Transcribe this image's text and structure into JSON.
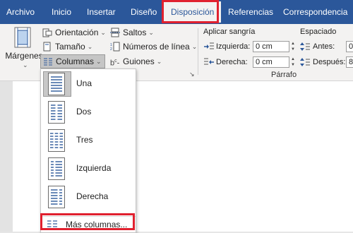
{
  "tabs": [
    {
      "label": "Archivo"
    },
    {
      "label": "Inicio"
    },
    {
      "label": "Insertar"
    },
    {
      "label": "Diseño"
    },
    {
      "label": "Disposición",
      "active": true
    },
    {
      "label": "Referencias"
    },
    {
      "label": "Correspondencia"
    }
  ],
  "ribbon": {
    "margins_label": "Márgenes",
    "orientation_label": "Orientación",
    "size_label": "Tamaño",
    "columns_label": "Columnas",
    "breaks_label": "Saltos",
    "line_numbers_label": "Números de línea",
    "hyphenation_label": "Guiones",
    "indent_title": "Aplicar sangría",
    "indent_left_label": "Izquierda:",
    "indent_left_value": "0 cm",
    "indent_right_label": "Derecha:",
    "indent_right_value": "0 cm",
    "spacing_title": "Espaciado",
    "spacing_before_label": "Antes:",
    "spacing_before_value": "0",
    "spacing_after_label": "Después:",
    "spacing_after_value": "8",
    "paragraph_group_label": "Párrafo"
  },
  "columns_menu": {
    "items": [
      {
        "label": "Una",
        "icon": "one-column-icon",
        "selected": true
      },
      {
        "label": "Dos",
        "icon": "two-columns-icon"
      },
      {
        "label": "Tres",
        "icon": "three-columns-icon"
      },
      {
        "label": "Izquierda",
        "icon": "left-column-icon"
      },
      {
        "label": "Derecha",
        "icon": "right-column-icon"
      }
    ],
    "more_label": "Más columnas..."
  },
  "colors": {
    "tab_bar": "#2b579a",
    "ribbon_bg": "#f3f2f1",
    "highlight": "#e0212f",
    "accent_blue": "#2b579a"
  }
}
